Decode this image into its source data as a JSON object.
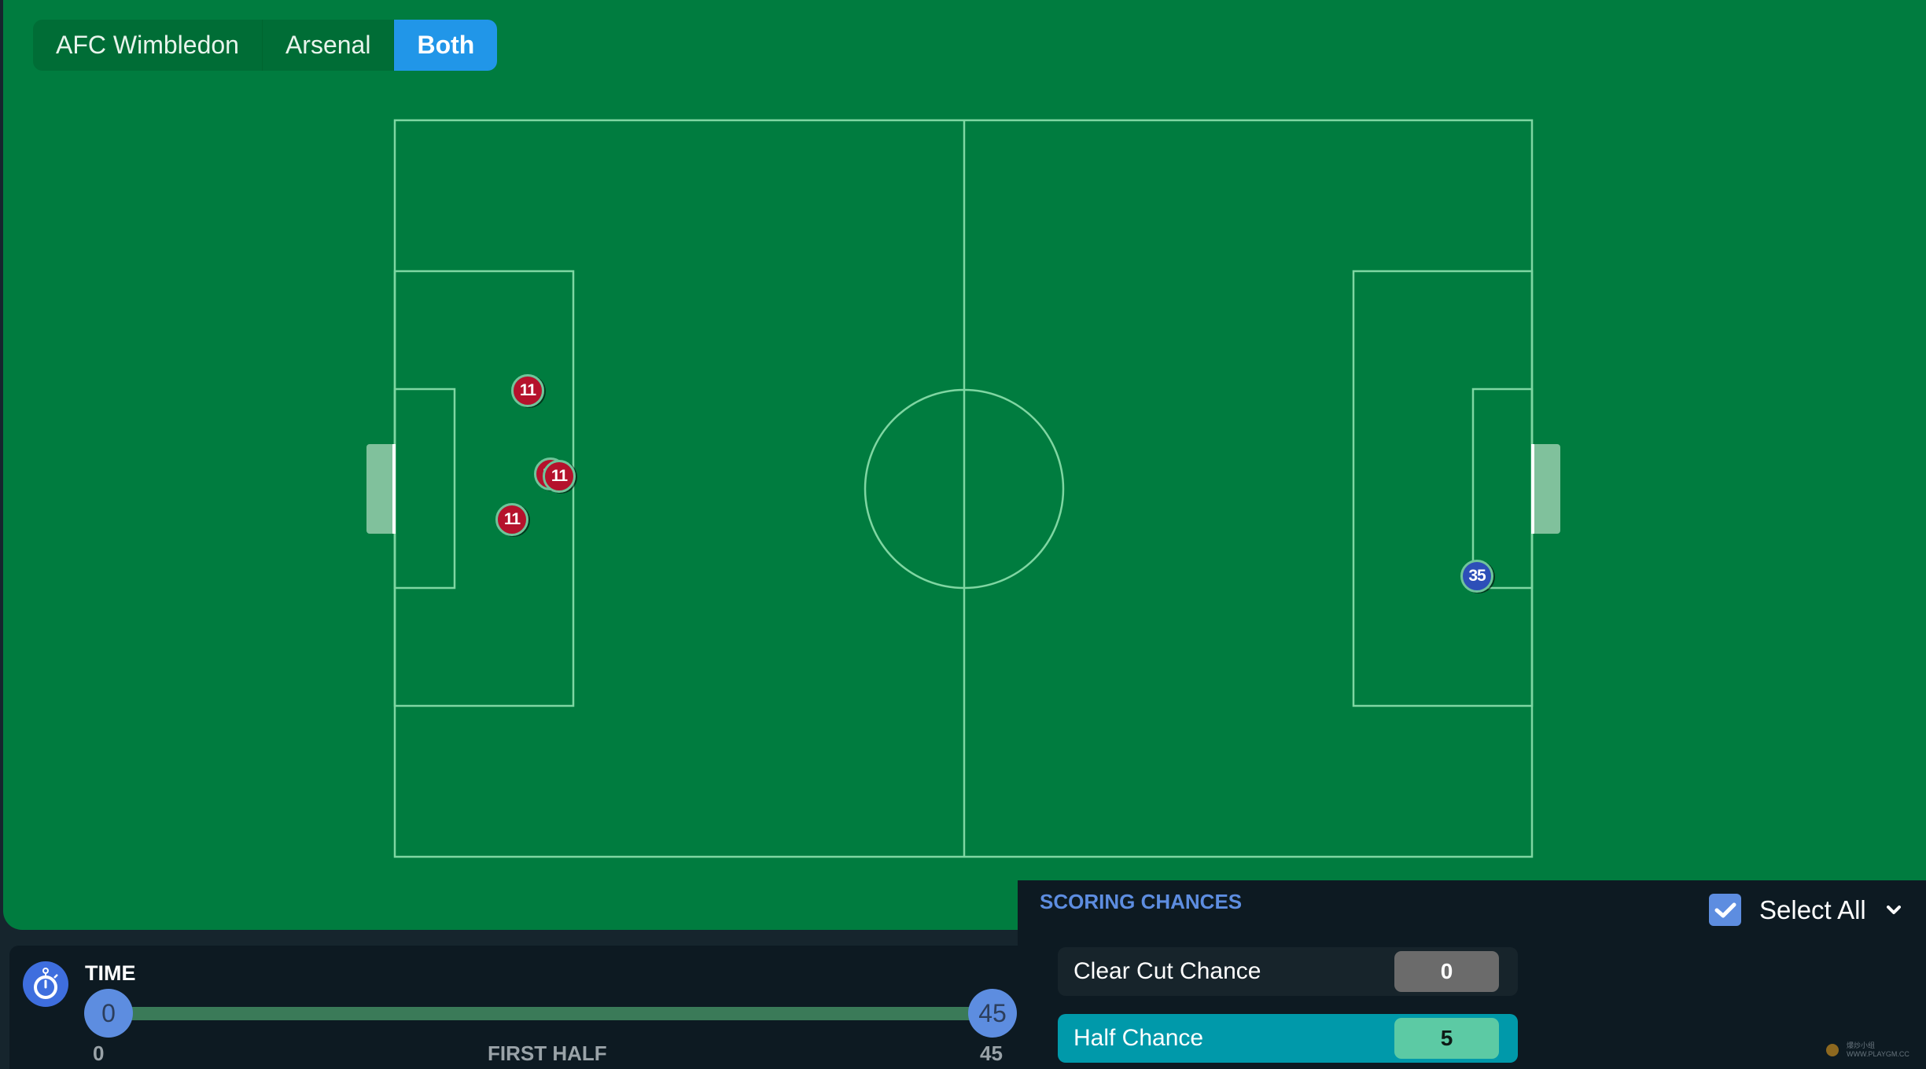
{
  "team_tabs": [
    {
      "label": "AFC Wimbledon",
      "active": false
    },
    {
      "label": "Arsenal",
      "active": false
    },
    {
      "label": "Both",
      "active": true
    }
  ],
  "markers": [
    {
      "number": "11",
      "team": "Arsenal",
      "color": "#b5122c"
    },
    {
      "number": "11",
      "team": "Arsenal",
      "color": "#b5122c"
    },
    {
      "number": "11",
      "team": "Arsenal",
      "color": "#b5122c"
    },
    {
      "number": "11",
      "team": "Arsenal",
      "color": "#b5122c"
    },
    {
      "number": "35",
      "team": "AFC Wimbledon",
      "color": "#2d4fb8"
    }
  ],
  "time": {
    "label": "TIME",
    "icon": "stopwatch-icon",
    "range_start": "0",
    "range_end": "45",
    "min_label": "0",
    "max_label": "45",
    "period_label": "FIRST HALF"
  },
  "scoring_chances": {
    "title": "SCORING CHANCES",
    "select_all_label": "Select All",
    "select_all_checked": true,
    "rows": [
      {
        "label": "Clear Cut Chance",
        "count": "0",
        "selected": false
      },
      {
        "label": "Half Chance",
        "count": "5",
        "selected": true
      }
    ]
  },
  "watermark": {
    "text_cn": "爆炒小组",
    "text_url": "WWW.PLAYGM.CC"
  },
  "colors": {
    "pitch": "#007c3f",
    "active_tab": "#2196e8",
    "accent_blue": "#5d8de0",
    "half_chance": "#0099aa"
  }
}
